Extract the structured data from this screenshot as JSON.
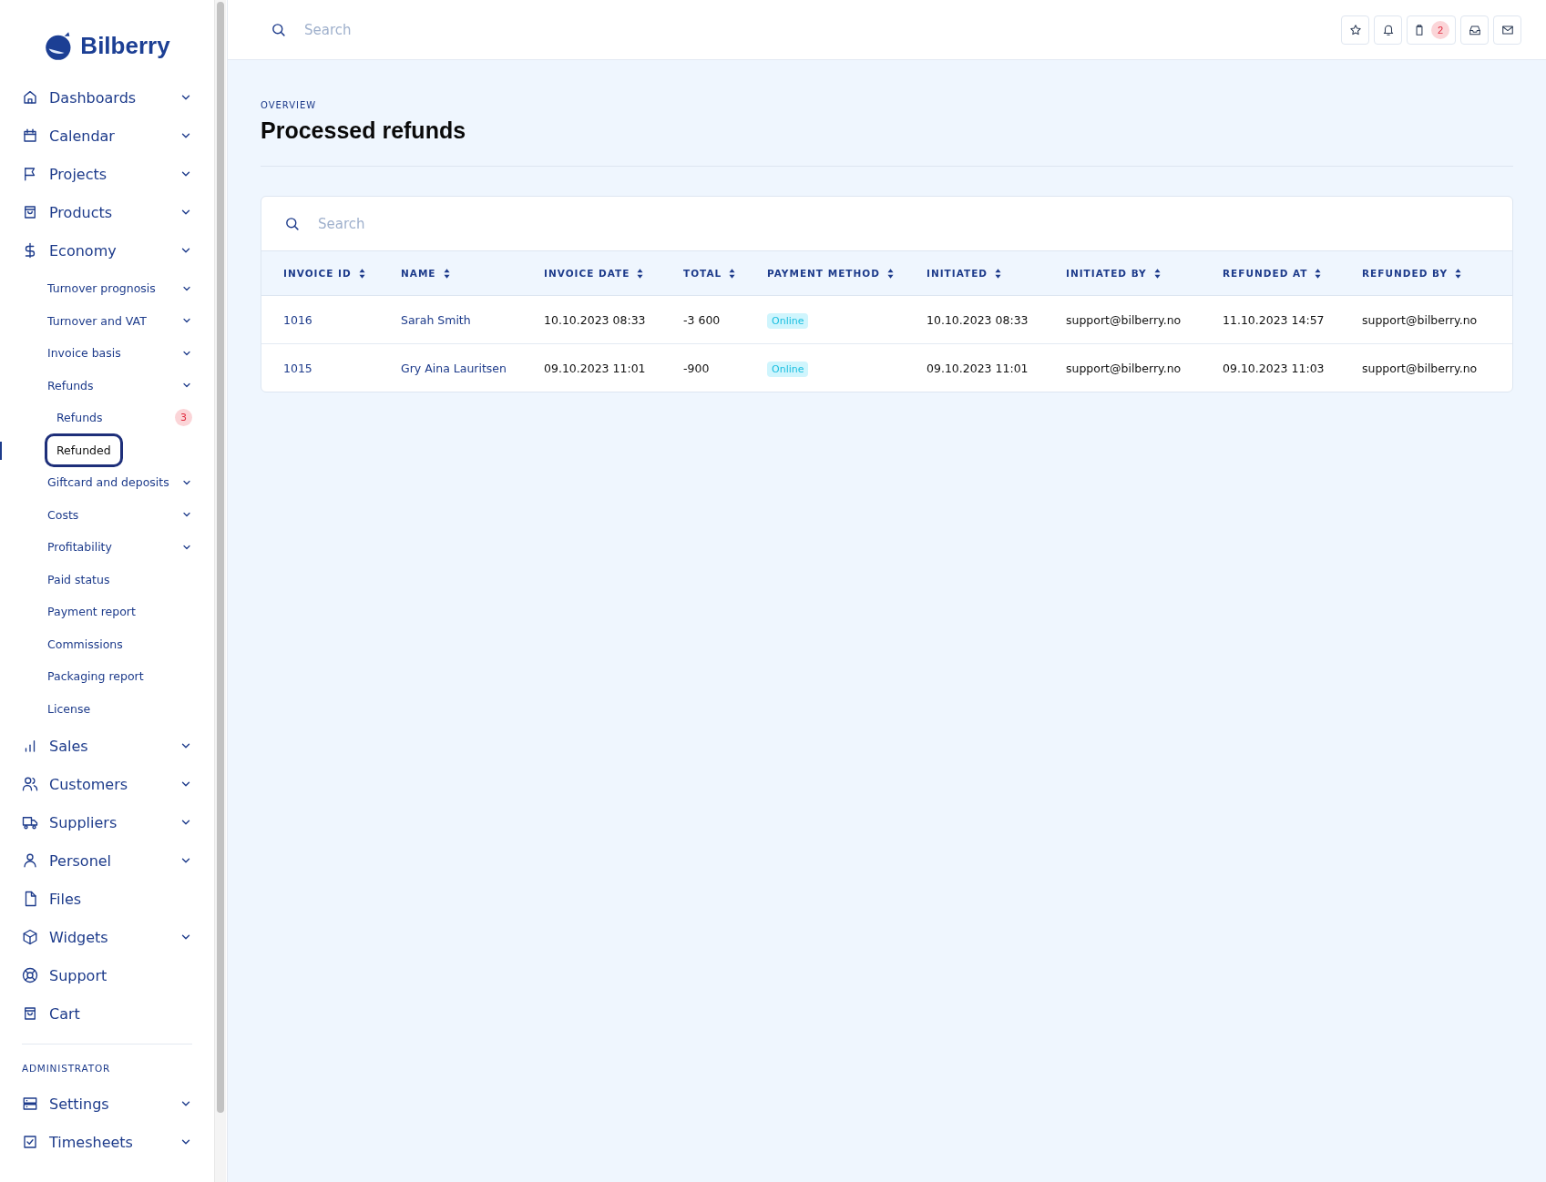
{
  "sidebar": {
    "logo": "Bilberry",
    "items": [
      {
        "label": "Dashboards",
        "expandable": true
      },
      {
        "label": "Calendar",
        "expandable": true
      },
      {
        "label": "Projects",
        "expandable": true
      },
      {
        "label": "Products",
        "expandable": true
      },
      {
        "label": "Economy",
        "expandable": true,
        "children": [
          {
            "label": "Turnover prognosis",
            "expandable": true
          },
          {
            "label": "Turnover and VAT",
            "expandable": true
          },
          {
            "label": "Invoice basis",
            "expandable": true
          },
          {
            "label": "Refunds",
            "expandable": true,
            "children": [
              {
                "label": "Refunds",
                "badge": "3",
                "selected": false
              },
              {
                "label": "Refunded",
                "selected": true
              }
            ]
          },
          {
            "label": "Giftcard and deposits",
            "expandable": true
          },
          {
            "label": "Costs",
            "expandable": true
          },
          {
            "label": "Profitability",
            "expandable": true
          },
          {
            "label": "Paid status",
            "expandable": false
          },
          {
            "label": "Payment report",
            "expandable": false
          },
          {
            "label": "Commissions",
            "expandable": false
          },
          {
            "label": "Packaging report",
            "expandable": false
          },
          {
            "label": "License",
            "expandable": false
          }
        ]
      },
      {
        "label": "Sales",
        "expandable": true
      },
      {
        "label": "Customers",
        "expandable": true
      },
      {
        "label": "Suppliers",
        "expandable": true
      },
      {
        "label": "Personel",
        "expandable": true
      },
      {
        "label": "Files",
        "expandable": false
      },
      {
        "label": "Widgets",
        "expandable": true
      },
      {
        "label": "Support",
        "expandable": false
      },
      {
        "label": "Cart",
        "expandable": false
      }
    ],
    "section_label": "ADMINISTRATOR",
    "admin_items": [
      {
        "label": "Settings",
        "expandable": true
      },
      {
        "label": "Timesheets",
        "expandable": true
      }
    ]
  },
  "topbar": {
    "search": {
      "placeholder": "Search"
    },
    "clipboard_badge": "2"
  },
  "header": {
    "eyebrow": "OVERVIEW",
    "title": "Processed refunds"
  },
  "table": {
    "search": {
      "placeholder": "Search"
    },
    "columns": [
      {
        "label": "INVOICE ID",
        "kind": "link"
      },
      {
        "label": "NAME",
        "kind": "link"
      },
      {
        "label": "INVOICE DATE",
        "kind": "text"
      },
      {
        "label": "TOTAL",
        "kind": "text"
      },
      {
        "label": "PAYMENT METHOD",
        "kind": "tag"
      },
      {
        "label": "INITIATED",
        "kind": "text"
      },
      {
        "label": "INITIATED BY",
        "kind": "text"
      },
      {
        "label": "REFUNDED AT",
        "kind": "text"
      },
      {
        "label": "REFUNDED BY",
        "kind": "text"
      }
    ],
    "rows": [
      [
        "1016",
        "Sarah Smith",
        "10.10.2023 08:33",
        "-3 600",
        "Online",
        "10.10.2023 08:33",
        "support@bilberry.no",
        "11.10.2023 14:57",
        "support@bilberry.no"
      ],
      [
        "1015",
        "Gry Aina Lauritsen",
        "09.10.2023 11:01",
        "-900",
        "Online",
        "09.10.2023 11:01",
        "support@bilberry.no",
        "09.10.2023 11:03",
        "support@bilberry.no"
      ]
    ]
  }
}
